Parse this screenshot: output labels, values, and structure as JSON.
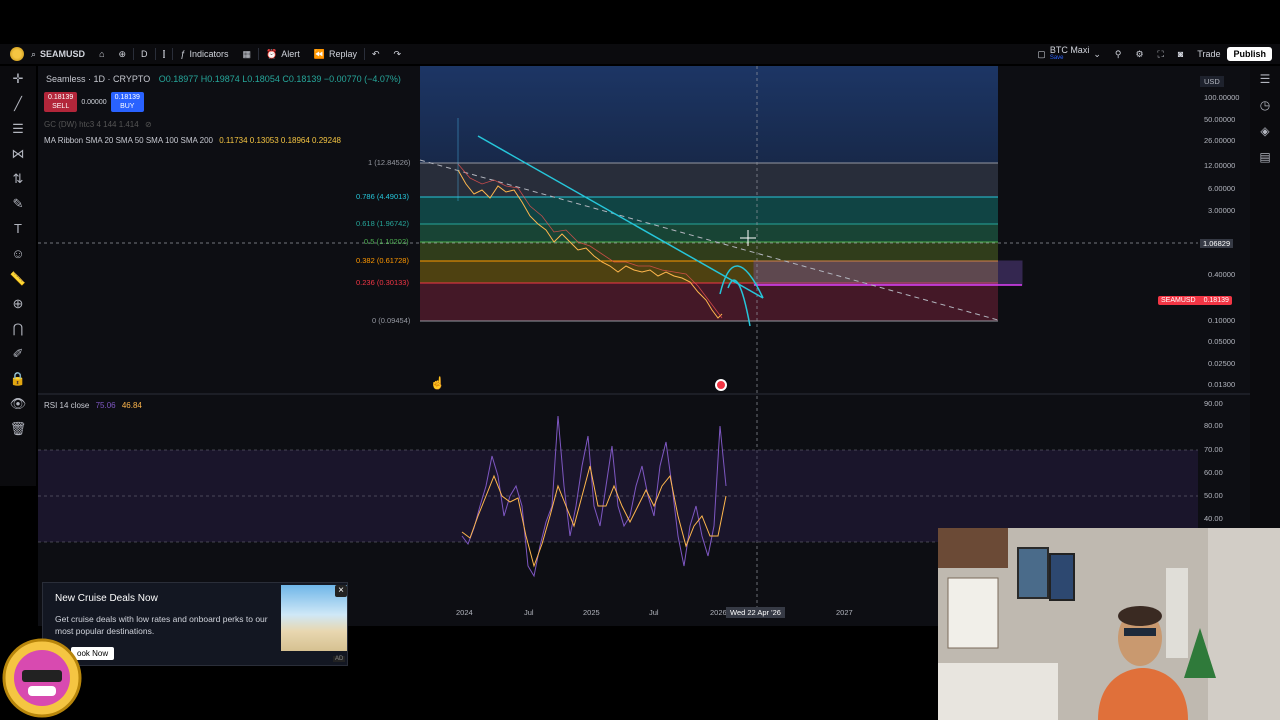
{
  "toolbar": {
    "symbol": "SEAMUSD",
    "interval": "D",
    "indicators": "Indicators",
    "alert": "Alert",
    "replay": "Replay",
    "layout_name": "BTC Maxi",
    "layout_sub": "Save",
    "trade": "Trade",
    "publish": "Publish"
  },
  "legend": {
    "title": "Seamless · 1D · CRYPTO",
    "ohlc": "O0.18977 H0.19874 L0.18054 C0.18139 −0.00770 (−4.07%)",
    "sell_price": "0.18139",
    "sell_label": "SELL",
    "spread": "0.00000",
    "buy_price": "0.18139",
    "buy_label": "BUY",
    "gc_line": "GC (DW) htc3 4 144 1.414",
    "ma_label": "MA Ribbon SMA 20 SMA 50 SMA 100 SMA 200",
    "ma_values": "0.11734 0.13053 0.18964 0.29248",
    "rsi_label": "RSI 14 close",
    "rsi_val1": "75.06",
    "rsi_val2": "46.84"
  },
  "fib_levels": [
    {
      "label": "1 (12.84526)"
    },
    {
      "label": "0.786 (4.49013)"
    },
    {
      "label": "0.618 (1.96742)"
    },
    {
      "label": "0.5 (1.10202)"
    },
    {
      "label": "0.382 (0.61728)"
    },
    {
      "label": "0.236 (0.30133)"
    },
    {
      "label": "0 (0.09454)"
    }
  ],
  "price_axis": {
    "currency": "USD",
    "ticks": [
      "100.00000",
      "50.00000",
      "26.00000",
      "12.00000",
      "6.00000",
      "3.00000",
      "1.06829",
      "0.40000",
      "0.10000",
      "0.05000",
      "0.02500",
      "0.01300"
    ],
    "symbol_tag": "SEAMUSD",
    "last_price": "0.18139"
  },
  "rsi_axis": {
    "ticks": [
      "90.00",
      "80.00",
      "70.00",
      "60.00",
      "50.00",
      "40.00"
    ]
  },
  "time_axis": {
    "ticks": [
      "2024",
      "Jul",
      "2025",
      "Jul",
      "2026",
      "2027"
    ],
    "crosshair": "Wed 22 Apr '26"
  },
  "ad": {
    "title": "New Cruise Deals Now",
    "body": "Get cruise deals with low rates and onboard perks to our most popular destinations.",
    "button": "ook Now",
    "tag": "AD"
  },
  "colors": {
    "bg": "#0d0e13",
    "teal": "#26c6da",
    "green": "#26a69a",
    "orange": "#ff9800",
    "red": "#f23645",
    "purple": "#7e57c2",
    "blue_zone": "#1e3a6e"
  }
}
